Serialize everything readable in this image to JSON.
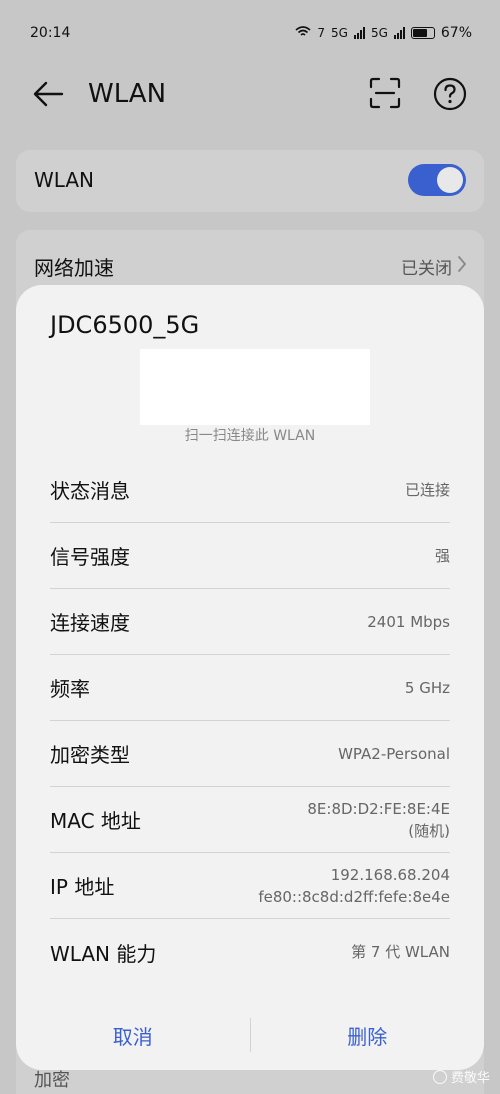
{
  "status_bar": {
    "time": "20:14",
    "wifi_label": "7",
    "sim1_label": "5G",
    "sim2_label": "5G",
    "battery": "67%"
  },
  "app_bar": {
    "title": "WLAN"
  },
  "wlan_card": {
    "label": "WLAN",
    "toggle_on": true
  },
  "accel_card": {
    "label": "网络加速",
    "value": "已关闭"
  },
  "bottom_card": {
    "label": "加密"
  },
  "dialog": {
    "ssid": "JDC6500_5G",
    "qr_hint": "扫一扫连接此 WLAN",
    "rows": [
      {
        "key": "状态消息",
        "value": "已连接"
      },
      {
        "key": "信号强度",
        "value": "强"
      },
      {
        "key": "连接速度",
        "value": "2401 Mbps"
      },
      {
        "key": "频率",
        "value": "5 GHz"
      },
      {
        "key": "加密类型",
        "value": "WPA2-Personal"
      },
      {
        "key": "MAC 地址",
        "value": "8E:8D:D2:FE:8E:4E",
        "value2": "(随机)"
      },
      {
        "key": "IP 地址",
        "value": "192.168.68.204",
        "value2": "fe80::8c8d:d2ff:fefe:8e4e"
      },
      {
        "key": "WLAN 能力",
        "value": "第 7 代 WLAN"
      }
    ],
    "cancel_label": "取消",
    "delete_label": "删除"
  },
  "watermark": "费敬华",
  "colors": {
    "accent": "#3a5fcf",
    "dim_background": "#c7c7c7",
    "dialog_background": "#f2f2f2"
  }
}
